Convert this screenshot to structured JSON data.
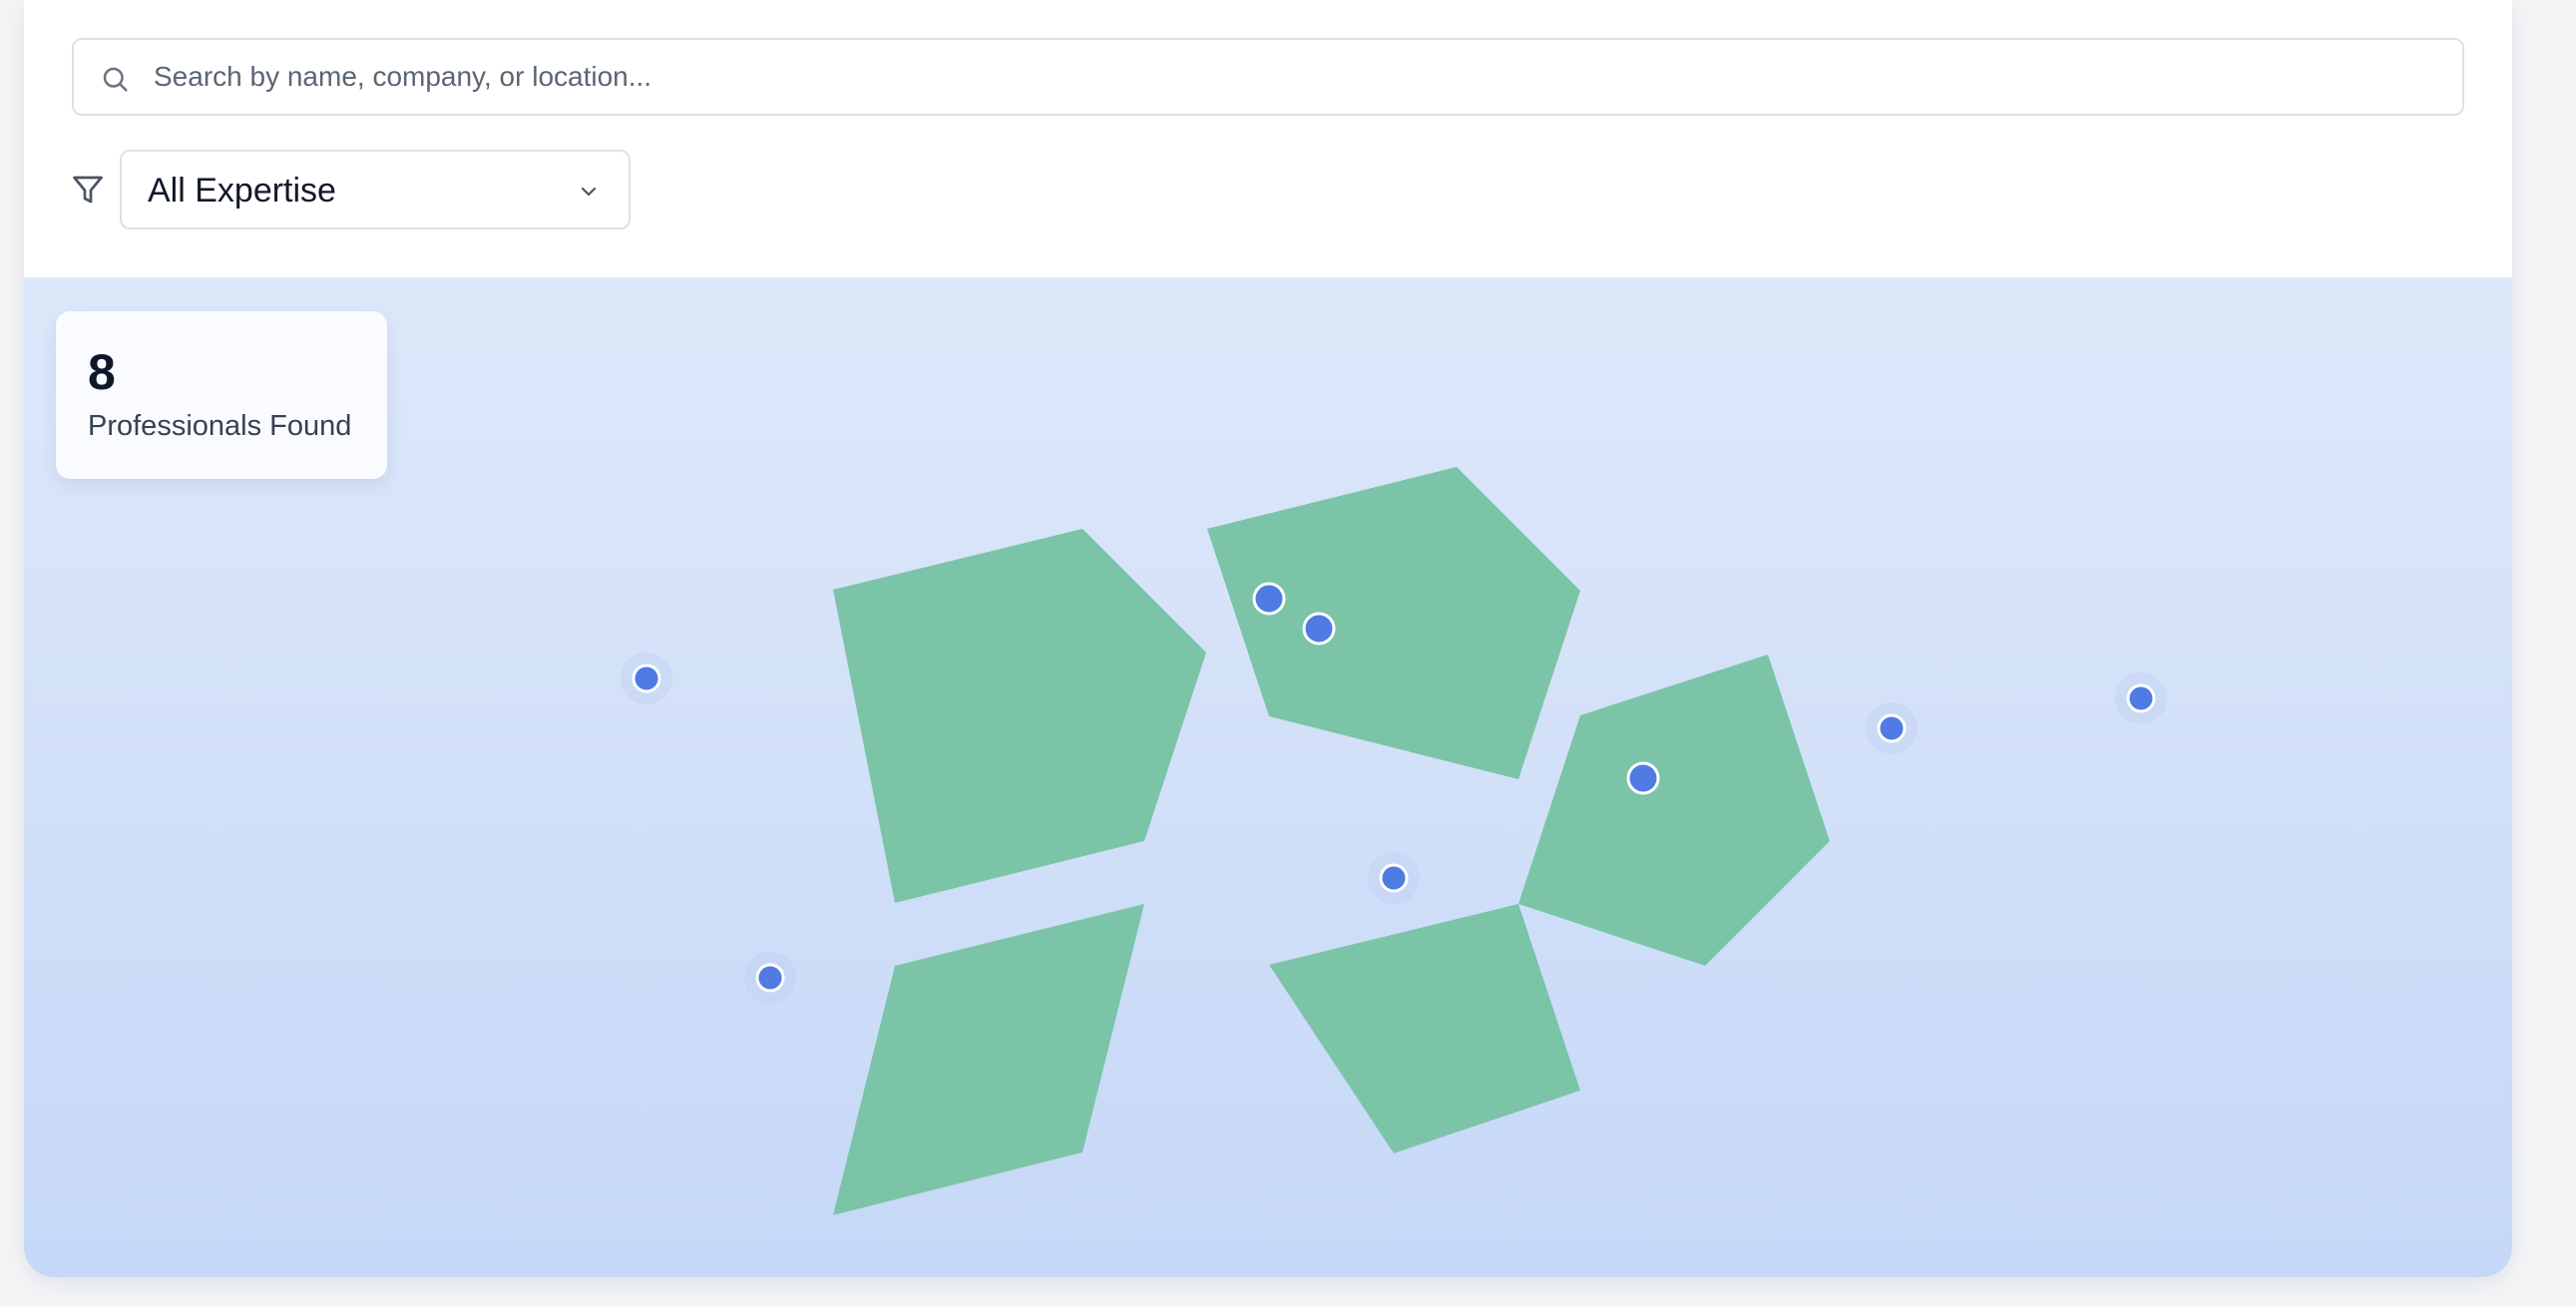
{
  "search": {
    "placeholder": "Search by name, company, or location..."
  },
  "filter": {
    "selected": "All Expertise"
  },
  "results": {
    "count": "8",
    "label": "Professionals Found"
  },
  "map": {
    "land_color": "#7bc4a8",
    "marker_color": "#4f7be3",
    "marker_stroke": "#ffffff",
    "land_shapes": [
      "region-west-upper",
      "region-west-lower",
      "region-central-upper",
      "region-central-lower",
      "region-east"
    ],
    "markers_count": 8
  }
}
